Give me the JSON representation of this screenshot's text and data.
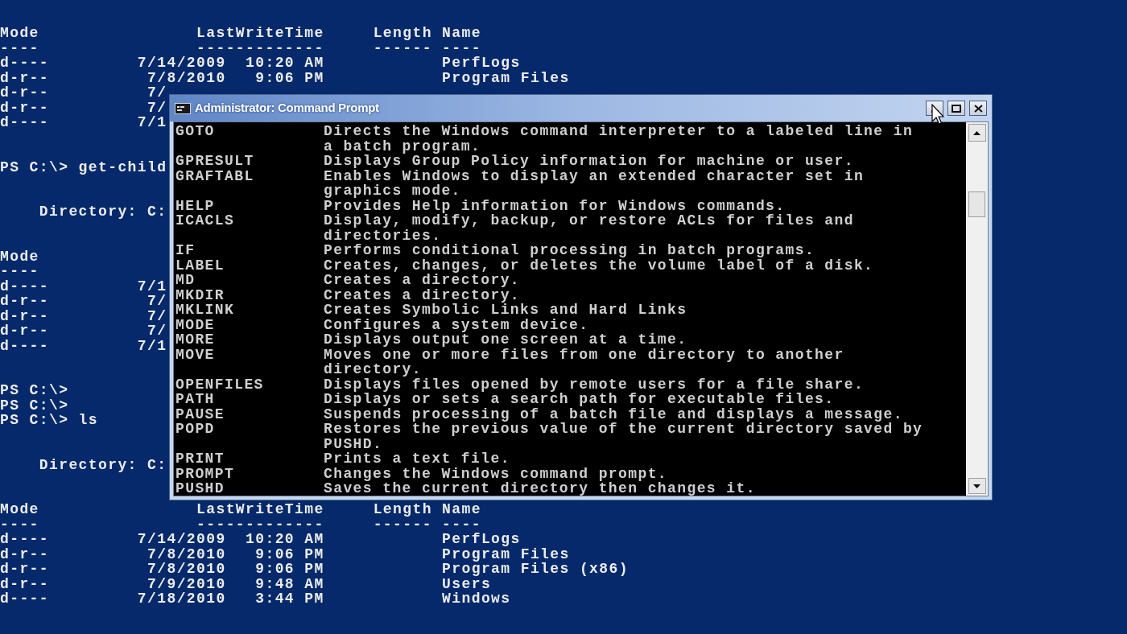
{
  "background_console": {
    "blocks": [
      {
        "lines": [
          "Mode                LastWriteTime     Length Name",
          "----                -------------     ------ ----",
          "d----         7/14/2009  10:20 AM            PerfLogs",
          "d-r--          7/8/2010   9:06 PM            Program Files",
          "d-r--          7/",
          "d-r--          7/",
          "d----         7/1"
        ]
      },
      {
        "lines": [
          "PS C:\\> get-child"
        ]
      },
      {
        "lines": [
          "    Directory: C:"
        ]
      },
      {
        "lines": [
          "Mode",
          "----",
          "d----         7/1",
          "d-r--          7/",
          "d-r--          7/",
          "d-r--          7/",
          "d----         7/1"
        ]
      },
      {
        "lines": [
          "PS C:\\>",
          "PS C:\\>",
          "PS C:\\> ls"
        ]
      },
      {
        "lines": [
          "    Directory: C:"
        ]
      },
      {
        "lines": [
          "Mode                LastWriteTime     Length Name",
          "----                -------------     ------ ----",
          "d----         7/14/2009  10:20 AM            PerfLogs",
          "d-r--          7/8/2010   9:06 PM            Program Files",
          "d-r--          7/8/2010   9:06 PM            Program Files (x86)",
          "d-r--          7/9/2010   9:48 AM            Users",
          "d----         7/18/2010   3:44 PM            Windows"
        ]
      }
    ]
  },
  "window": {
    "title": "Administrator: Command Prompt",
    "help_entries": [
      {
        "command": "GOTO",
        "description": [
          "Directs the Windows command interpreter to a labeled line in",
          "a batch program."
        ]
      },
      {
        "command": "GPRESULT",
        "description": [
          "Displays Group Policy information for machine or user."
        ]
      },
      {
        "command": "GRAFTABL",
        "description": [
          "Enables Windows to display an extended character set in",
          "graphics mode."
        ]
      },
      {
        "command": "HELP",
        "description": [
          "Provides Help information for Windows commands."
        ]
      },
      {
        "command": "ICACLS",
        "description": [
          "Display, modify, backup, or restore ACLs for files and",
          "directories."
        ]
      },
      {
        "command": "IF",
        "description": [
          "Performs conditional processing in batch programs."
        ]
      },
      {
        "command": "LABEL",
        "description": [
          "Creates, changes, or deletes the volume label of a disk."
        ]
      },
      {
        "command": "MD",
        "description": [
          "Creates a directory."
        ]
      },
      {
        "command": "MKDIR",
        "description": [
          "Creates a directory."
        ]
      },
      {
        "command": "MKLINK",
        "description": [
          "Creates Symbolic Links and Hard Links"
        ]
      },
      {
        "command": "MODE",
        "description": [
          "Configures a system device."
        ]
      },
      {
        "command": "MORE",
        "description": [
          "Displays output one screen at a time."
        ]
      },
      {
        "command": "MOVE",
        "description": [
          "Moves one or more files from one directory to another",
          "directory."
        ]
      },
      {
        "command": "OPENFILES",
        "description": [
          "Displays files opened by remote users for a file share."
        ]
      },
      {
        "command": "PATH",
        "description": [
          "Displays or sets a search path for executable files."
        ]
      },
      {
        "command": "PAUSE",
        "description": [
          "Suspends processing of a batch file and displays a message."
        ]
      },
      {
        "command": "POPD",
        "description": [
          "Restores the previous value of the current directory saved by",
          "PUSHD."
        ]
      },
      {
        "command": "PRINT",
        "description": [
          "Prints a text file."
        ]
      },
      {
        "command": "PROMPT",
        "description": [
          "Changes the Windows command prompt."
        ]
      },
      {
        "command": "PUSHD",
        "description": [
          "Saves the current directory then changes it."
        ]
      }
    ]
  }
}
